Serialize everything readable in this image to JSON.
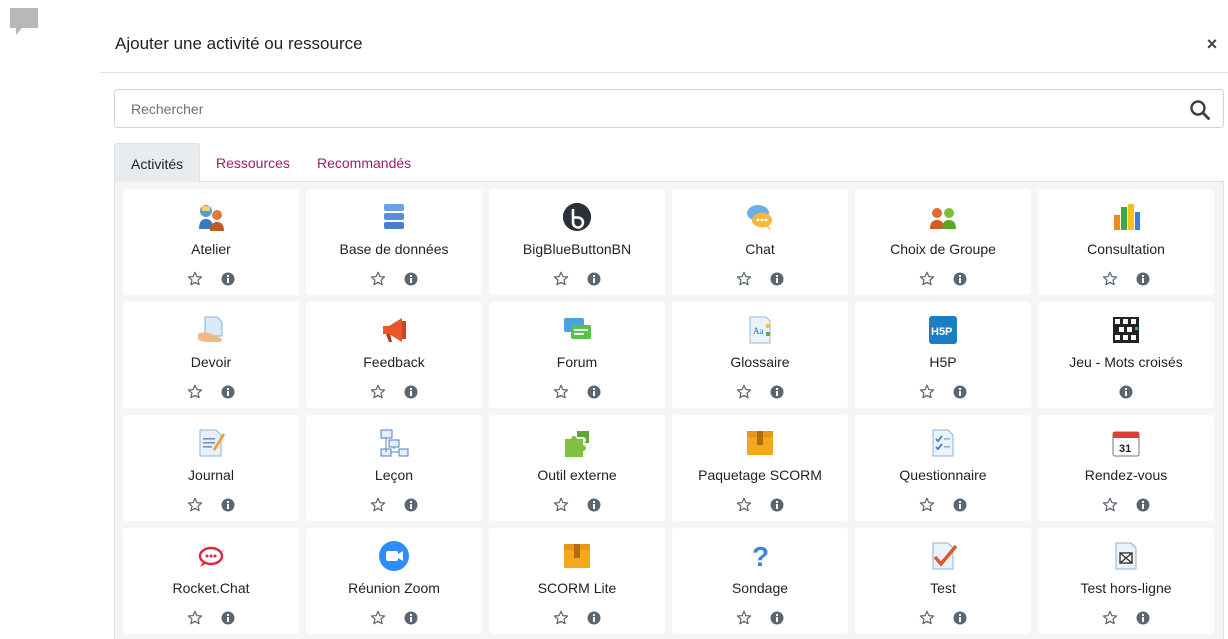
{
  "modal": {
    "title": "Ajouter une activité ou ressource",
    "close_symbol": "×"
  },
  "search": {
    "placeholder": "Rechercher",
    "value": ""
  },
  "tabs": [
    {
      "label": "Activités",
      "active": true
    },
    {
      "label": "Ressources",
      "active": false
    },
    {
      "label": "Recommandés",
      "active": false
    }
  ],
  "colors": {
    "accent": "#9c1d6f",
    "panel_bg": "#f5f5f5",
    "text": "#1d2125"
  },
  "activities": [
    {
      "label": "Atelier",
      "icon": "workshop-icon",
      "favourite": true
    },
    {
      "label": "Base de données",
      "icon": "database-icon",
      "favourite": true
    },
    {
      "label": "BigBlueButtonBN",
      "icon": "bigbluebutton-icon",
      "favourite": true
    },
    {
      "label": "Chat",
      "icon": "chat-icon",
      "favourite": true
    },
    {
      "label": "Choix de Groupe",
      "icon": "group-choice-icon",
      "favourite": true
    },
    {
      "label": "Consultation",
      "icon": "bar-chart-icon",
      "favourite": true
    },
    {
      "label": "Devoir",
      "icon": "assignment-icon",
      "favourite": true
    },
    {
      "label": "Feedback",
      "icon": "megaphone-icon",
      "favourite": true
    },
    {
      "label": "Forum",
      "icon": "forum-icon",
      "favourite": true
    },
    {
      "label": "Glossaire",
      "icon": "glossary-icon",
      "favourite": true
    },
    {
      "label": "H5P",
      "icon": "h5p-icon",
      "favourite": true
    },
    {
      "label": "Jeu - Mots croisés",
      "icon": "crossword-icon",
      "favourite": false
    },
    {
      "label": "Journal",
      "icon": "journal-icon",
      "favourite": true
    },
    {
      "label": "Leçon",
      "icon": "lesson-icon",
      "favourite": true
    },
    {
      "label": "Outil externe",
      "icon": "puzzle-icon",
      "favourite": true
    },
    {
      "label": "Paquetage SCORM",
      "icon": "scorm-package-icon",
      "favourite": true
    },
    {
      "label": "Questionnaire",
      "icon": "questionnaire-icon",
      "favourite": true
    },
    {
      "label": "Rendez-vous",
      "icon": "calendar-icon",
      "favourite": true
    },
    {
      "label": "Rocket.Chat",
      "icon": "rocketchat-icon",
      "favourite": true
    },
    {
      "label": "Réunion Zoom",
      "icon": "zoom-icon",
      "favourite": true
    },
    {
      "label": "SCORM Lite",
      "icon": "scorm-lite-icon",
      "favourite": true
    },
    {
      "label": "Sondage",
      "icon": "question-mark-icon",
      "favourite": true
    },
    {
      "label": "Test",
      "icon": "test-icon",
      "favourite": true
    },
    {
      "label": "Test hors-ligne",
      "icon": "offline-test-icon",
      "favourite": true
    }
  ]
}
